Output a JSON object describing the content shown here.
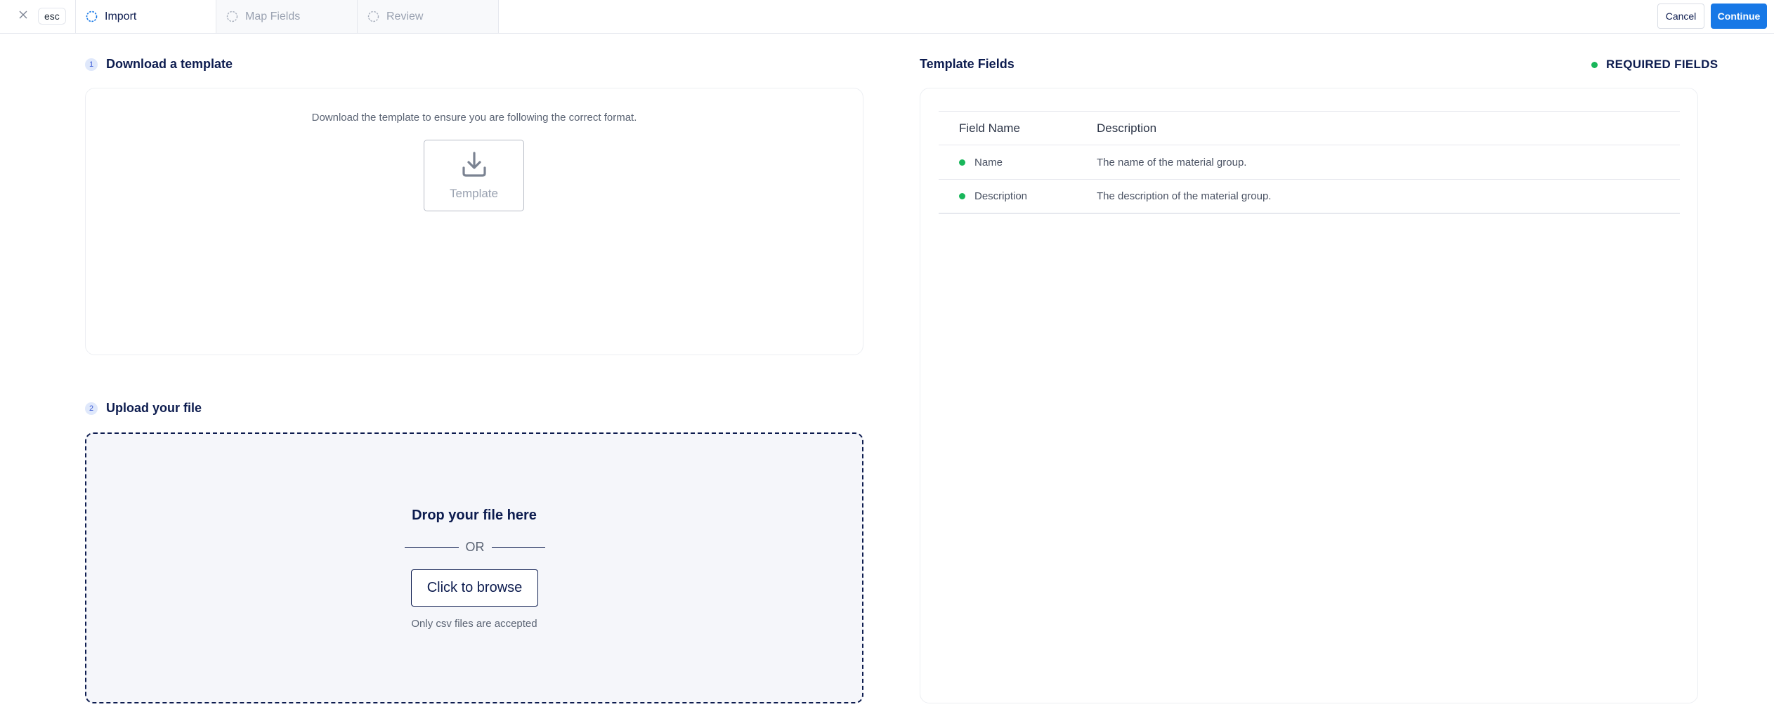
{
  "topbar": {
    "esc_label": "esc",
    "steps": [
      {
        "label": "Import",
        "state": "active"
      },
      {
        "label": "Map Fields",
        "state": "inactive"
      },
      {
        "label": "Review",
        "state": "inactive"
      }
    ],
    "cancel_label": "Cancel",
    "continue_label": "Continue"
  },
  "download_section": {
    "number": "1",
    "title": "Download a template",
    "description": "Download the template to ensure you are following the correct format.",
    "template_button_label": "Template"
  },
  "upload_section": {
    "number": "2",
    "title": "Upload your file",
    "drop_text": "Drop your file here",
    "or_text": "OR",
    "browse_label": "Click to browse",
    "accept_note": "Only csv files are accepted"
  },
  "template_fields": {
    "title": "Template Fields",
    "legend": "REQUIRED FIELDS",
    "columns": [
      "Field Name",
      "Description"
    ],
    "rows": [
      {
        "name": "Name",
        "description": "The name of the material group.",
        "required": true
      },
      {
        "name": "Description",
        "description": "The description of the material group.",
        "required": true
      }
    ]
  },
  "colors": {
    "primary_navy": "#0d1c4f",
    "accent_blue": "#1778e6",
    "required_green": "#18b65a",
    "muted_gray": "#9aa2b1"
  }
}
